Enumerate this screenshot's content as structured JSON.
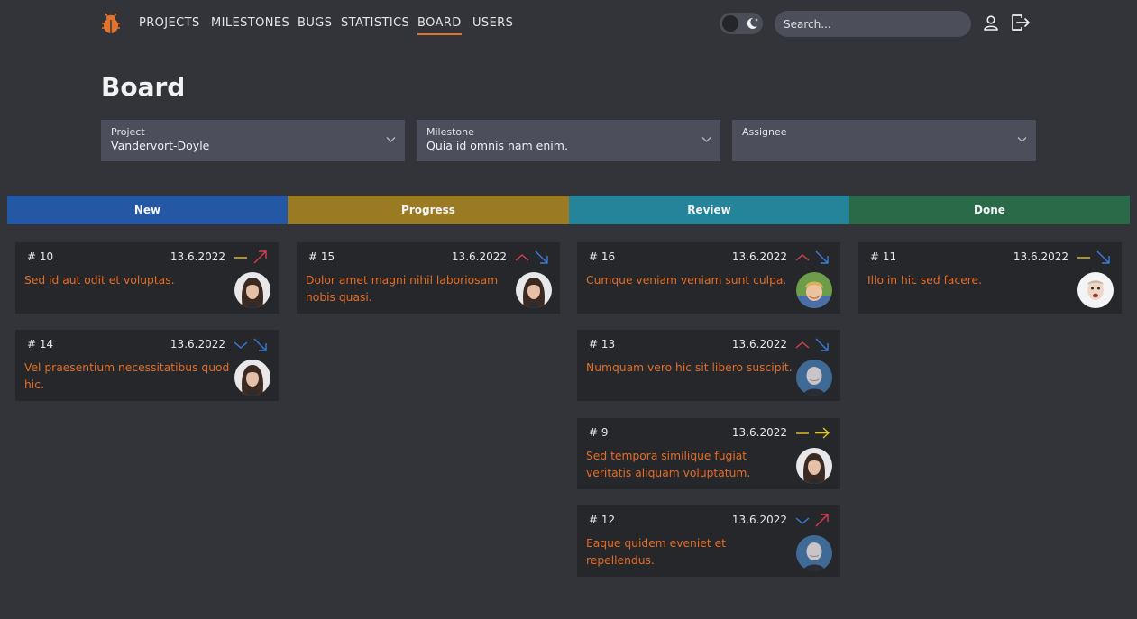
{
  "nav": {
    "logo_icon": "bug-icon",
    "items": [
      {
        "label": "PROJECTS",
        "active": false
      },
      {
        "label": "MILESTONES",
        "active": false
      },
      {
        "label": "BUGS",
        "active": false
      },
      {
        "label": "STATISTICS",
        "active": false
      },
      {
        "label": "BOARD",
        "active": true
      },
      {
        "label": "USERS",
        "active": false
      }
    ],
    "search_placeholder": "Search...",
    "accent_color": "#e0742c"
  },
  "page": {
    "title": "Board"
  },
  "filters": [
    {
      "label": "Project",
      "value": "Vandervort-Doyle"
    },
    {
      "label": "Milestone",
      "value": "Quia id omnis nam enim."
    },
    {
      "label": "Assignee",
      "value": ""
    }
  ],
  "columns": [
    {
      "name": "New",
      "color": "#2458a4",
      "cards": [
        {
          "number": "# 10",
          "date": "13.6.2022",
          "priority": "medium",
          "severity": "up-right-red",
          "title": "Sed id aut odit et voluptas.",
          "avatar": "avatar-woman-dark-hair"
        },
        {
          "number": "# 14",
          "date": "13.6.2022",
          "priority": "low",
          "severity": "down-right-blue",
          "title": "Vel praesentium necessitatibus quod hic.",
          "avatar": "avatar-woman-dark-hair"
        }
      ]
    },
    {
      "name": "Progress",
      "color": "#9a7b24",
      "cards": [
        {
          "number": "# 15",
          "date": "13.6.2022",
          "priority": "high",
          "severity": "down-right-blue",
          "title": "Dolor amet magni nihil laboriosam nobis quasi.",
          "avatar": "avatar-woman-dark-hair"
        }
      ]
    },
    {
      "name": "Review",
      "color": "#24849a",
      "cards": [
        {
          "number": "# 16",
          "date": "13.6.2022",
          "priority": "high",
          "severity": "down-right-blue",
          "title": "Cumque veniam veniam sunt culpa.",
          "avatar": "avatar-blond-man"
        },
        {
          "number": "# 13",
          "date": "13.6.2022",
          "priority": "high",
          "severity": "down-right-blue",
          "title": "Numquam vero hic sit libero suscipit.",
          "avatar": "avatar-bald-man"
        },
        {
          "number": "# 9",
          "date": "13.6.2022",
          "priority": "medium",
          "severity": "right-yellow",
          "title": "Sed tempora similique fugiat veritatis aliquam voluptatum.",
          "avatar": "avatar-woman-dark-hair"
        },
        {
          "number": "# 12",
          "date": "13.6.2022",
          "priority": "low",
          "severity": "up-right-red",
          "title": "Eaque quidem eveniet et repellendus.",
          "avatar": "avatar-bald-man"
        }
      ]
    },
    {
      "name": "Done",
      "color": "#2a6a48",
      "cards": [
        {
          "number": "# 11",
          "date": "13.6.2022",
          "priority": "medium",
          "severity": "down-right-blue",
          "title": "Illo in hic sed facere.",
          "avatar": "avatar-man-funny-face"
        }
      ]
    }
  ],
  "colors": {
    "priority_high": "#d93d4e",
    "priority_medium": "#e8c420",
    "priority_low": "#3b7bd8",
    "severity_red": "#d93d4e",
    "severity_blue": "#3b7bd8",
    "severity_yellow": "#e8c420",
    "card_title": "#e36c26"
  }
}
